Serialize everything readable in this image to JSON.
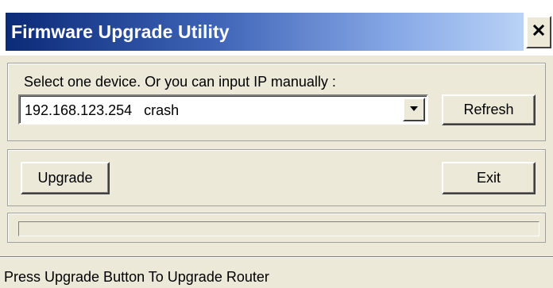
{
  "window": {
    "title": "Firmware Upgrade Utility",
    "colors": {
      "titlebar_dark": "#0b2a78",
      "titlebar_light": "#b9d2f6",
      "face": "#ece9d8"
    }
  },
  "device": {
    "label": "Select one device. Or you can input IP manually :",
    "selected": "192.168.123.254   crash"
  },
  "buttons": {
    "refresh": "Refresh",
    "upgrade": "Upgrade",
    "exit": "Exit"
  },
  "progress": {
    "value": 0
  },
  "status": {
    "text": "Press Upgrade Button To Upgrade Router"
  },
  "icons": {
    "close": "close-icon",
    "dropdown": "chevron-down-icon"
  }
}
